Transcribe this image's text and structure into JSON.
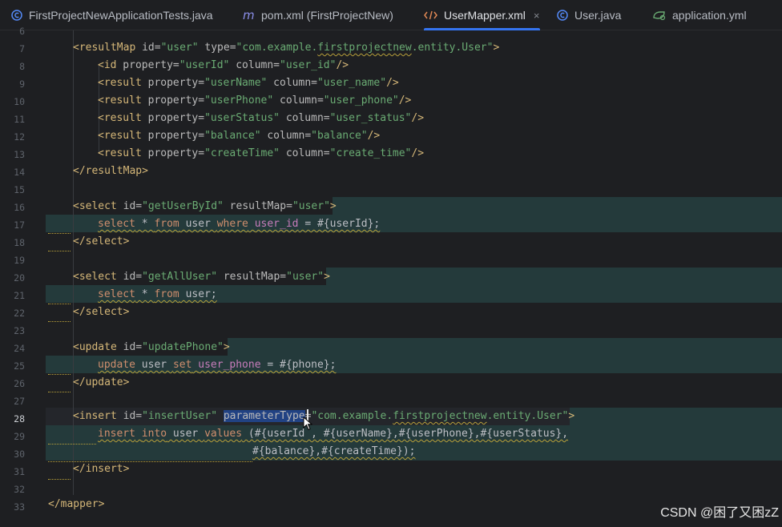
{
  "tabs": [
    {
      "label": "FirstProjectNewApplicationTests.java",
      "icon": "java-class-icon",
      "active": false
    },
    {
      "label": "pom.xml (FirstProjectNew)",
      "icon": "maven-icon",
      "active": false
    },
    {
      "label": "UserMapper.xml",
      "icon": "xml-file-icon",
      "active": true,
      "close": "×"
    },
    {
      "label": "User.java",
      "icon": "java-class-icon",
      "active": false
    },
    {
      "label": "application.yml",
      "icon": "spring-config-icon",
      "active": false
    }
  ],
  "line_numbers": [
    "6",
    "7",
    "8",
    "9",
    "10",
    "11",
    "12",
    "13",
    "14",
    "15",
    "16",
    "17",
    "18",
    "19",
    "20",
    "21",
    "22",
    "23",
    "24",
    "25",
    "26",
    "27",
    "28",
    "29",
    "30",
    "31",
    "32",
    "33"
  ],
  "current_line": "28",
  "code": {
    "l7": [
      "<resultMap",
      " id=",
      "\"user\"",
      " type=",
      "\"com.example.",
      "firstprojectnew",
      ".entity.User\"",
      ">"
    ],
    "l8": [
      "<id",
      " property=",
      "\"userId\"",
      " column=",
      "\"user_id\"",
      "/>"
    ],
    "l9": [
      "<result",
      " property=",
      "\"userName\"",
      " column=",
      "\"user_name\"",
      "/>"
    ],
    "l10": [
      "<result",
      " property=",
      "\"userPhone\"",
      " column=",
      "\"user_phone\"",
      "/>"
    ],
    "l11": [
      "<result",
      " property=",
      "\"userStatus\"",
      " column=",
      "\"user_status\"",
      "/>"
    ],
    "l12": [
      "<result",
      " property=",
      "\"balance\"",
      " column=",
      "\"balance\"",
      "/>"
    ],
    "l13": [
      "<result",
      " property=",
      "\"createTime\"",
      " column=",
      "\"create_time\"",
      "/>"
    ],
    "l14": [
      "</resultMap>"
    ],
    "l16": [
      "<select",
      " id=",
      "\"getUserById\"",
      " resultMap=",
      "\"user\"",
      ">"
    ],
    "l17": [
      "select",
      " * ",
      "from",
      " user ",
      "where",
      " ",
      "user_id",
      " = #{userId};"
    ],
    "l18": [
      "</select>"
    ],
    "l20": [
      "<select",
      " id=",
      "\"getAllUser\"",
      " resultMap=",
      "\"user\"",
      ">"
    ],
    "l21": [
      "select",
      " * ",
      "from",
      " user;"
    ],
    "l22": [
      "</select>"
    ],
    "l24": [
      "<update",
      " id=",
      "\"updatePhone\"",
      ">"
    ],
    "l25": [
      "update",
      " user ",
      "set",
      " ",
      "user_phone",
      " = #{phone};"
    ],
    "l26": [
      "</update>"
    ],
    "l28": [
      "<insert",
      " id=",
      "\"insertUser\"",
      " ",
      "parameterType",
      "=",
      "\"com.example.",
      "firstprojectnew",
      ".entity.User\"",
      ">"
    ],
    "l29": [
      "insert",
      " ",
      "into",
      " user ",
      "values",
      " (#{userId",
      " , #{userName},#{userPhone},#{userStatus},"
    ],
    "l30": [
      "#{balance},#{createTime});"
    ],
    "l31": [
      "</insert>"
    ],
    "l33": [
      "</mapper>"
    ]
  },
  "watermark": "CSDN @困了又困zZ",
  "colors": {
    "tag": "#d5b778",
    "attribute": "#bababa",
    "string": "#6aab73",
    "sql_keyword": "#cf8e6d",
    "sql_column": "#c77dbb",
    "injected_bg": "#243a3b",
    "selection": "#214283",
    "tab_underline": "#3574f0"
  }
}
